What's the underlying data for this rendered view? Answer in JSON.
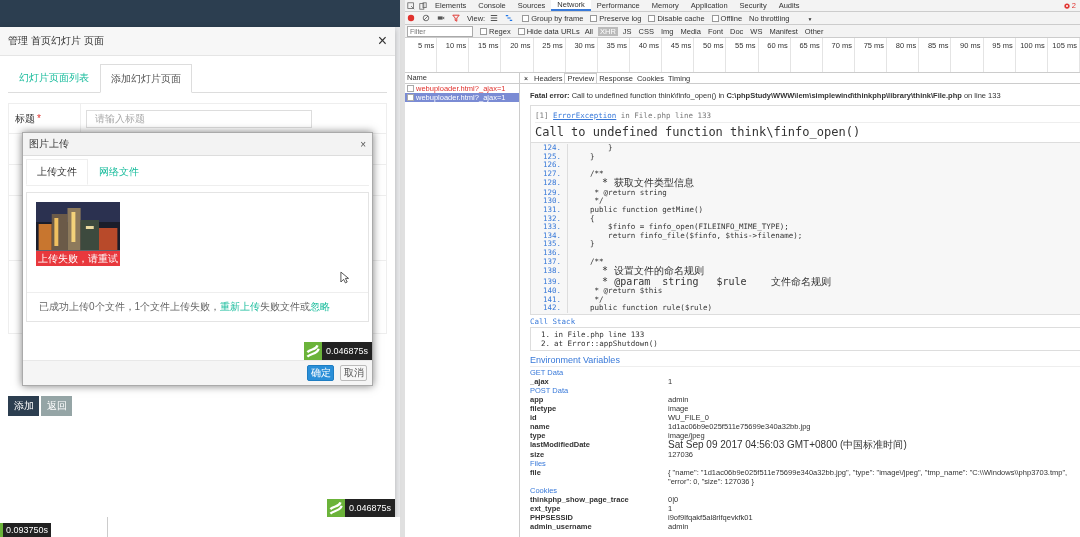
{
  "page": {
    "modal": {
      "title": "管理 首页幻灯片 页面",
      "close": "×",
      "tabs": [
        {
          "label": "幻灯片页面列表",
          "selected": false
        },
        {
          "label": "添加幻灯片页面",
          "selected": true
        }
      ],
      "form": {
        "label": "标题",
        "required_mark": "*",
        "placeholder": "请输入标题"
      },
      "buttons": [
        {
          "label": "添加",
          "kind": "primary"
        },
        {
          "label": "返回",
          "kind": "secondary"
        }
      ],
      "trace_badge": "0.046875s"
    },
    "bottom_badge": "0.093750s"
  },
  "upload_dialog": {
    "title": "图片上传",
    "close": "×",
    "tabs": [
      {
        "label": "上传文件",
        "selected": true
      },
      {
        "label": "网络文件",
        "selected": false
      }
    ],
    "thumbnail": {
      "kind": "picture",
      "status": "上传失败，请重试"
    },
    "status": [
      {
        "kind": "text",
        "text": "已成功上传0个文件，1个文件上传失败，"
      },
      {
        "kind": "link",
        "text": "重新上传"
      },
      {
        "kind": "text",
        "text": "失败文件或"
      },
      {
        "kind": "link",
        "text": "忽略"
      }
    ],
    "trace_badge": "0.046875s",
    "buttons": [
      {
        "label": "确定",
        "kind": "primary"
      },
      {
        "label": "取消",
        "kind": "default"
      }
    ]
  },
  "devtools": {
    "tabs": [
      {
        "label": "Elements",
        "selected": false
      },
      {
        "label": "Console",
        "selected": false
      },
      {
        "label": "Sources",
        "selected": false
      },
      {
        "label": "Network",
        "selected": true
      },
      {
        "label": "Performance",
        "selected": false
      },
      {
        "label": "Memory",
        "selected": false
      },
      {
        "label": "Application",
        "selected": false
      },
      {
        "label": "Security",
        "selected": false
      },
      {
        "label": "Audits",
        "selected": false
      }
    ],
    "error_count": "2",
    "toolbar": {
      "view_label": "View:",
      "options": [
        {
          "label": "Group by frame",
          "checked": false
        },
        {
          "label": "Preserve log",
          "checked": false
        },
        {
          "label": "Disable cache",
          "checked": false
        },
        {
          "label": "Offline",
          "checked": false
        }
      ],
      "throttling": "No throttling",
      "throttling_caret": "▼"
    },
    "filter": {
      "placeholder": "Filter",
      "options": [
        {
          "label": "Regex",
          "checked": false
        },
        {
          "label": "Hide data URLs",
          "checked": false
        }
      ],
      "types": [
        {
          "label": "All",
          "selected": false
        },
        {
          "label": "XHR",
          "selected": true
        },
        {
          "label": "JS",
          "selected": false
        },
        {
          "label": "CSS",
          "selected": false
        },
        {
          "label": "Img",
          "selected": false
        },
        {
          "label": "Media",
          "selected": false
        },
        {
          "label": "Font",
          "selected": false
        },
        {
          "label": "Doc",
          "selected": false
        },
        {
          "label": "WS",
          "selected": false
        },
        {
          "label": "Manifest",
          "selected": false
        },
        {
          "label": "Other",
          "selected": false
        }
      ]
    },
    "timeline_ticks": [
      "5 ms",
      "10 ms",
      "15 ms",
      "20 ms",
      "25 ms",
      "30 ms",
      "35 ms",
      "40 ms",
      "45 ms",
      "50 ms",
      "55 ms",
      "60 ms",
      "65 ms",
      "70 ms",
      "75 ms",
      "80 ms",
      "85 ms",
      "90 ms",
      "95 ms",
      "100 ms",
      "105 ms"
    ],
    "name_header": "Name",
    "requests": [
      {
        "name": "webuploader.html?_ajax=1",
        "selected": false
      },
      {
        "name": "webuploader.html?_ajax=1",
        "selected": true
      }
    ],
    "close": "×",
    "detail_tabs": [
      {
        "label": "Headers",
        "selected": false
      },
      {
        "label": "Preview",
        "selected": true
      },
      {
        "label": "Response",
        "selected": false
      },
      {
        "label": "Cookies",
        "selected": false
      },
      {
        "label": "Timing",
        "selected": false
      }
    ],
    "preview": {
      "fatal": "**Fatal error:** Call to undefined function think\\finfo_open() in **C:\\phpStudy\\WWW\\lem\\simplewind\\thinkphp\\library\\think\\File.php** on line 133",
      "exception": {
        "index": "[1]",
        "class": "ErrorException",
        "location": "in File.php line 133"
      },
      "message": "Call to undefined function think\\finfo_open()",
      "code": [
        {
          "no": "124.",
          "text": "        }"
        },
        {
          "no": "125.",
          "text": "    }"
        },
        {
          "no": "126."
        },
        {
          "no": "127.",
          "text": "    /**"
        },
        {
          "no": "128.",
          "text": "     * 获取文件类型信息"
        },
        {
          "no": "129.",
          "text": "     * @return string"
        },
        {
          "no": "130.",
          "text": "     */"
        },
        {
          "no": "131.",
          "text": "    public function getMime()"
        },
        {
          "no": "132.",
          "text": "    {"
        },
        {
          "no": "133.",
          "text": "        $finfo = finfo_open(FILEINFO_MIME_TYPE);"
        },
        {
          "no": "134.",
          "text": "        return finfo_file($finfo, $this->filename);"
        },
        {
          "no": "135.",
          "text": "    }"
        },
        {
          "no": "136."
        },
        {
          "no": "137.",
          "text": "    /**"
        },
        {
          "no": "138.",
          "text": "     * 设置文件的命名规则"
        },
        {
          "no": "139.",
          "text": "     * @param  string   $rule    文件命名规则"
        },
        {
          "no": "140.",
          "text": "     * @return $this"
        },
        {
          "no": "141.",
          "text": "     */"
        },
        {
          "no": "142.",
          "text": "    public function rule($rule)"
        }
      ],
      "call_stack_title": "Call Stack",
      "call_stack": [
        {
          "no": "1.",
          "text": "in File.php line 133"
        },
        {
          "no": "2.",
          "text": "at Error::appShutdown()"
        }
      ],
      "env_title": "Environment Variables",
      "env": [
        {
          "heading": "GET Data",
          "rows": [
            {
              "key": "_ajax",
              "value": "1"
            }
          ]
        },
        {
          "heading": "POST Data",
          "rows": [
            {
              "key": "app",
              "value": "admin"
            },
            {
              "key": "filetype",
              "value": "image"
            },
            {
              "key": "id",
              "value": "WU_FILE_0"
            },
            {
              "key": "name",
              "value": "1d1ac06b9e025f511e75699e340a32bb.jpg"
            },
            {
              "key": "type",
              "value": "image/jpeg"
            },
            {
              "key": "lastModifiedDate",
              "value": "Sat Sep 09 2017 04:56:03 GMT+0800 (中国标准时间)"
            },
            {
              "key": "size",
              "value": "127036"
            }
          ]
        },
        {
          "heading": "Files",
          "rows": [
            {
              "key": "file",
              "value": "{ \"name\": \"1d1ac06b9e025f511e75699e340a32bb.jpg\", \"type\": \"image\\/jpeg\", \"tmp_name\": \"C:\\\\Windows\\\\php3703.tmp\", \"error\": 0, \"size\": 127036 }"
            }
          ]
        },
        {
          "heading": "Cookies",
          "rows": [
            {
              "key": "thinkphp_show_page_trace",
              "value": "0|0"
            },
            {
              "key": "ext_type",
              "value": "1"
            },
            {
              "key": "PHPSESSID",
              "value": "i9of9lfqakf5al8rlfqevkfk01"
            },
            {
              "key": "admin_username",
              "value": "admin"
            }
          ]
        }
      ]
    }
  }
}
